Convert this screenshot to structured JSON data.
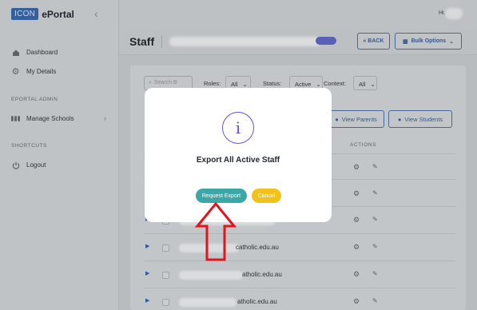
{
  "sidebar": {
    "brand_box": "ICON",
    "brand_name": "ePortal",
    "collapse_icon": "chevron-left-icon",
    "items": [
      {
        "label": "Dashboard",
        "icon": "dashboard-icon"
      },
      {
        "label": "My Details",
        "icon": "gear-icon"
      }
    ],
    "section_admin": "EPORTAL ADMIN",
    "admin_items": [
      {
        "label": "Manage Schools",
        "icon": "schools-icon"
      }
    ],
    "section_shortcuts": "SHORTCUTS",
    "shortcut_items": [
      {
        "label": "Logout",
        "icon": "power-icon"
      }
    ]
  },
  "header": {
    "greeting": "Hi, c"
  },
  "page": {
    "title": "Staff",
    "back_label": "« BACK",
    "bulk_label": "Bulk Options"
  },
  "filters": {
    "search_placeholder": "Search B",
    "roles_label": "Roles:",
    "roles_value": "All",
    "status_label": "Status:",
    "status_value": "Active",
    "context_label": "Context:",
    "context_value": "All"
  },
  "table": {
    "view_parents": "View Parents",
    "view_students": "View Students",
    "actions_header": "ACTIONS",
    "emails": [
      "",
      "",
      "",
      "catholic.edu.au",
      "atholic.edu.au",
      "atholic.edu.au"
    ]
  },
  "modal": {
    "title": "Export All Active Staff",
    "icon": "info-icon",
    "primary_label": "Request Export",
    "cancel_label": "Cancel"
  },
  "colors": {
    "accent_teal": "#3ca7a7",
    "cancel_yellow": "#f2c21b",
    "info_purple": "#6d50c9",
    "annotation_red": "#e0161e"
  }
}
